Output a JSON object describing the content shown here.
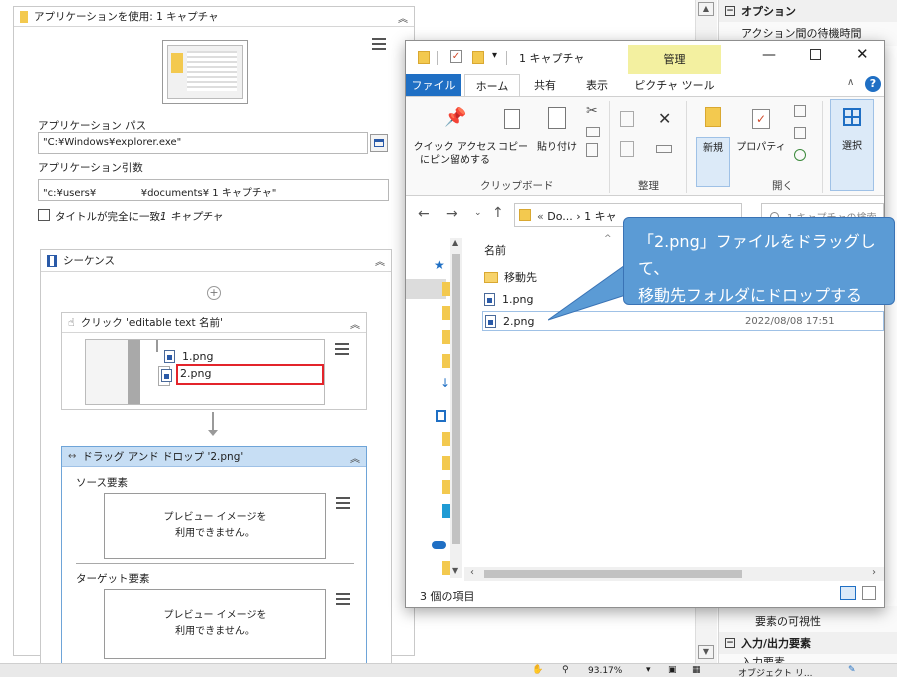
{
  "designer": {
    "app_scope": {
      "title": "アプリケーションを使用: 1 キャプチャ"
    },
    "app_path": {
      "label": "アプリケーション パス",
      "value": "\"C:¥Windows¥explorer.exe\""
    },
    "app_args": {
      "label": "アプリケーション引数",
      "value": "\"c:¥users¥              ¥documents¥ 1 キャプチャ\""
    },
    "title_match": {
      "label": "タイトルが完全に一致:",
      "value": "1 キャプチャ",
      "checked": false
    },
    "sequence": {
      "title": "シーケンス"
    },
    "click_activity": {
      "title": "クリック 'editable text  名前'",
      "items": [
        "1.png",
        "2.png"
      ]
    },
    "drag_drop": {
      "title": "ドラッグ アンド ドロップ '2.png'",
      "source_label": "ソース要素",
      "target_label": "ターゲット要素",
      "preview_line1": "プレビュー イメージを",
      "preview_line2": "利用できません。"
    }
  },
  "properties": {
    "options_header": "オプション",
    "wait_time": "アクション間の待機時間",
    "visibility": "要素の可視性",
    "io_header": "入力/出力要素",
    "input_element": "入力要素"
  },
  "explorer": {
    "title": "1 キャプチャ",
    "manage_tab": "管理",
    "tabs": [
      "ファイル",
      "ホーム",
      "共有",
      "表示",
      "ピクチャ ツール"
    ],
    "ribbon": {
      "pin": "クイック アクセス\nにピン留めする",
      "copy": "コピー",
      "paste": "貼り付け",
      "new": "新規",
      "properties": "プロパティ",
      "select": "選択",
      "groups": [
        "クリップボード",
        "整理",
        "開く"
      ]
    },
    "address": "Do...  ›  1 キャ",
    "search_placeholder": "1 キャプチャの検索",
    "column_name": "名前",
    "files": [
      {
        "name": "移動先",
        "kind": "folder",
        "date": ""
      },
      {
        "name": "1.png",
        "kind": "image",
        "date": ""
      },
      {
        "name": "2.png",
        "kind": "image",
        "date": "2022/08/08 17:51"
      }
    ],
    "status": "3 個の項目"
  },
  "callout": {
    "line1": "「2.png」ファイルをドラッグして、",
    "line2": "移動先フォルダにドロップする"
  },
  "statusbar": {
    "zoom": "93.17%",
    "object_repo": "オブジェクト リ..."
  },
  "colors": {
    "accent": "#1f6fc4",
    "callout": "#5b9bd5",
    "manage_tab": "#f3f0a0",
    "selection": "#cce8ff",
    "highlight_red": "#e3242b"
  }
}
